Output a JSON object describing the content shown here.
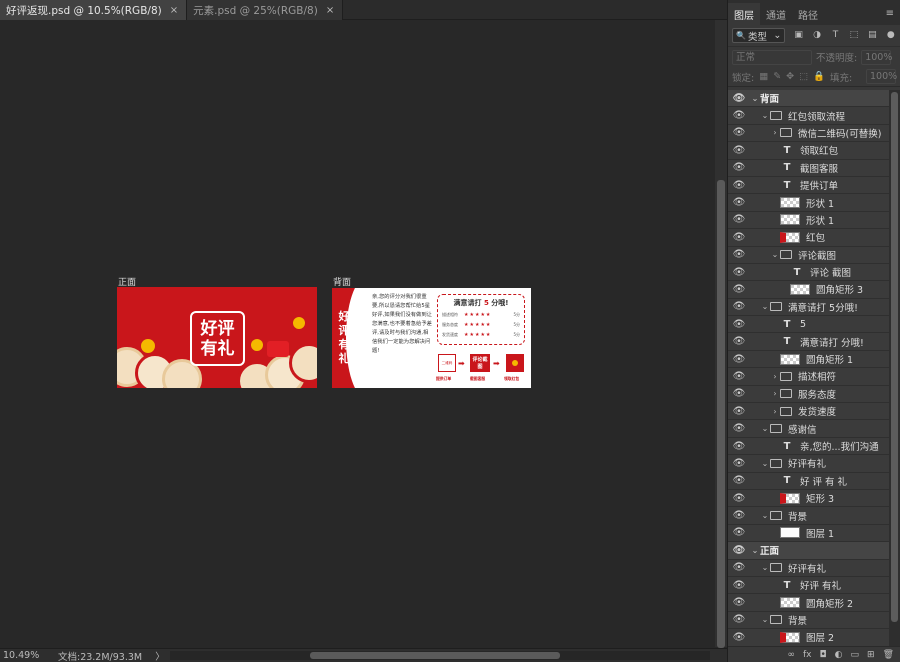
{
  "tabs": [
    {
      "label": "好评返现.psd @ 10.5%(RGB/8)",
      "active": true
    },
    {
      "label": "元素.psd @ 25%(RGB/8)",
      "active": false
    }
  ],
  "tab_close": "×",
  "artboards": {
    "front_label": "正面",
    "back_label": "背面"
  },
  "front": {
    "title_line1": "好评",
    "title_line2": "有礼"
  },
  "back": {
    "vertical_title": [
      "好",
      "评",
      "有",
      "礼"
    ],
    "paragraph": "亲,您的评分对我们很重要,所以恳请您帮忙给5星好评,如果我们没有做到让您满意,也不要着急给予差评,请及时与我们沟通,相信我们一定能为您解决问题!",
    "rating_title_prefix": "满意请打",
    "rating_number": "5",
    "rating_title_suffix": "分哦!",
    "rating_rows": [
      {
        "label": "描述相符",
        "stars": "★★★★★",
        "score": "5分"
      },
      {
        "label": "服务态度",
        "stars": "★★★★★",
        "score": "5分"
      },
      {
        "label": "发货速度",
        "stars": "★★★★★",
        "score": "5分"
      }
    ],
    "steps": [
      {
        "box": "二维码",
        "caption": "提供订单"
      },
      {
        "box": "评论截图",
        "caption": "截图客服"
      },
      {
        "box": "",
        "caption": "领取红包"
      }
    ],
    "arrow": "➡"
  },
  "status": {
    "zoom": "10.49%",
    "doc": "文档:23.2M/93.3M",
    "arrow": "〉"
  },
  "panel": {
    "tabs": [
      "图层",
      "通道",
      "路径"
    ],
    "menu_icon": "≡",
    "filter_label": "类型",
    "filter_icon_search": "🔍",
    "filter_chevron": "⌄",
    "blend_mode": "正常",
    "opacity_label": "不透明度:",
    "opacity_value": "100%",
    "lock_label": "锁定:",
    "fill_label": "填充:",
    "fill_value": "100%",
    "footer_icons": [
      "∞",
      "fx",
      "◘",
      "◐",
      "▭",
      "⊞",
      "🗑"
    ]
  },
  "layers": [
    {
      "name": "背面",
      "type": "group-top",
      "indent": 0
    },
    {
      "name": "红包领取流程",
      "type": "group",
      "indent": 1
    },
    {
      "name": "微信二维码(可替换)",
      "type": "group-closed",
      "indent": 2
    },
    {
      "name": "领取红包",
      "type": "text",
      "indent": 2
    },
    {
      "name": "截图客服",
      "type": "text",
      "indent": 2
    },
    {
      "name": "提供订单",
      "type": "text",
      "indent": 2
    },
    {
      "name": "形状 1",
      "type": "shape",
      "indent": 2
    },
    {
      "name": "形状 1",
      "type": "shape",
      "indent": 2
    },
    {
      "name": "红包",
      "type": "shape-red",
      "indent": 2
    },
    {
      "name": "评论截图",
      "type": "group",
      "indent": 2
    },
    {
      "name": "评论 截图",
      "type": "text",
      "indent": 3
    },
    {
      "name": "圆角矩形 3",
      "type": "shape",
      "indent": 3
    },
    {
      "name": "满意请打 5分哦!",
      "type": "group",
      "indent": 1
    },
    {
      "name": "5",
      "type": "text",
      "indent": 2
    },
    {
      "name": "满意请打    分哦!",
      "type": "text",
      "indent": 2
    },
    {
      "name": "圆角矩形 1",
      "type": "shape",
      "indent": 2
    },
    {
      "name": "描述相符",
      "type": "group-closed",
      "indent": 2
    },
    {
      "name": "服务态度",
      "type": "group-closed",
      "indent": 2
    },
    {
      "name": "发货速度",
      "type": "group-closed",
      "indent": 2
    },
    {
      "name": "感谢信",
      "type": "group",
      "indent": 1
    },
    {
      "name": "亲,您的...我们沟通",
      "type": "text",
      "indent": 2
    },
    {
      "name": "好评有礼",
      "type": "group",
      "indent": 1
    },
    {
      "name": "好 评 有 礼",
      "type": "text",
      "indent": 2
    },
    {
      "name": "矩形 3",
      "type": "shape-redchk",
      "indent": 2
    },
    {
      "name": "背景",
      "type": "group",
      "indent": 1
    },
    {
      "name": "图层 1",
      "type": "shape-white",
      "indent": 2
    },
    {
      "name": "正面",
      "type": "group-top",
      "indent": 0
    },
    {
      "name": "好评有礼",
      "type": "group",
      "indent": 1
    },
    {
      "name": "好评 有礼",
      "type": "text",
      "indent": 2
    },
    {
      "name": "圆角矩形 2",
      "type": "shape",
      "indent": 2
    },
    {
      "name": "背景",
      "type": "group",
      "indent": 1
    },
    {
      "name": "图层 2",
      "type": "shape-red",
      "indent": 2
    }
  ]
}
